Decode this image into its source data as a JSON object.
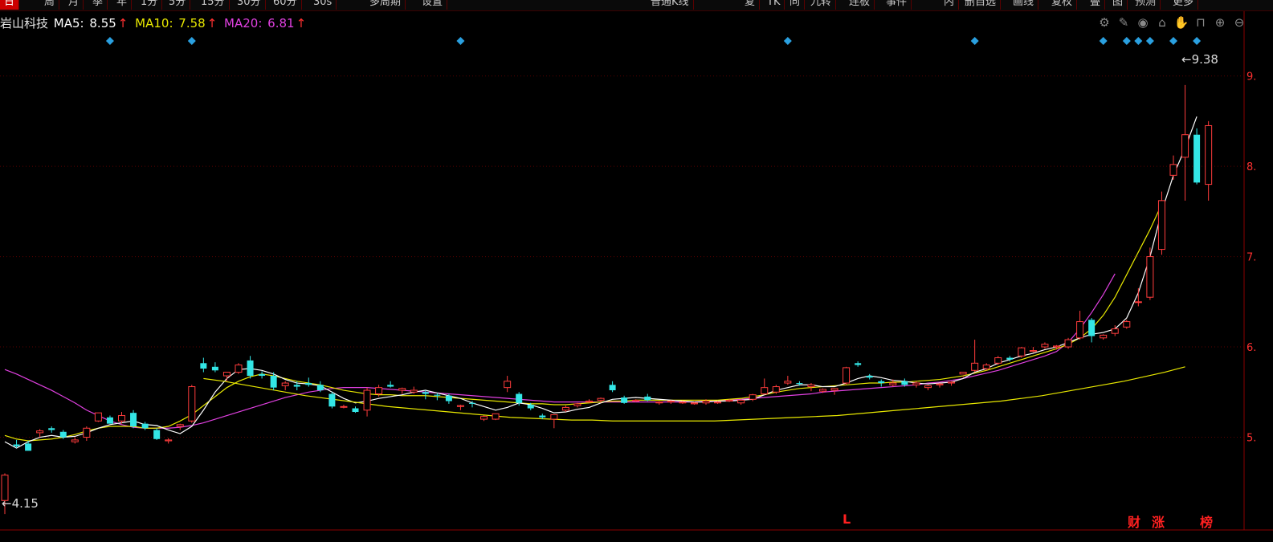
{
  "toolbar": {
    "items": [
      {
        "label": "日",
        "active": true
      },
      {
        "label": "周"
      },
      {
        "label": "月"
      },
      {
        "label": "季"
      },
      {
        "label": "年"
      },
      {
        "label": "1分"
      },
      {
        "label": "5分"
      },
      {
        "label": "15分"
      },
      {
        "label": "30分"
      },
      {
        "label": "60分"
      },
      {
        "label": "30s"
      },
      {
        "label": "多周期"
      },
      {
        "label": "设置"
      }
    ],
    "right_items": [
      {
        "label": "普通K线"
      },
      {
        "label": "复"
      },
      {
        "label": "TK"
      },
      {
        "label": "同"
      },
      {
        "label": "九转"
      },
      {
        "label": "连板"
      },
      {
        "label": "事件"
      },
      {
        "label": "内"
      },
      {
        "label": "删自选"
      },
      {
        "label": "画线"
      },
      {
        "label": "复权"
      },
      {
        "label": "叠"
      },
      {
        "label": "图"
      },
      {
        "label": "预测"
      },
      {
        "label": "更多"
      }
    ]
  },
  "info": {
    "stock_name": "岩山科技",
    "ma5_label": "MA5:",
    "ma5_value": "8.55",
    "ma10_label": "MA10:",
    "ma10_value": "7.58",
    "ma20_label": "MA20:",
    "ma20_value": "6.81",
    "up_arrow": "↑"
  },
  "tools": [
    "gear-icon",
    "pen-icon",
    "eye-icon",
    "basket-icon",
    "hand-icon",
    "lock-icon",
    "zoom-in-icon",
    "zoom-out-icon"
  ],
  "tool_glyphs": [
    "⚙",
    "✎",
    "◉",
    "⌂",
    "✋",
    "⊓",
    "⊕",
    "⊖"
  ],
  "badges": {
    "l": "L",
    "cai": "财",
    "zhang": "涨",
    "bang": "榜"
  },
  "chart_data": {
    "type": "candlestick",
    "up_color": "#ff3c3c",
    "down_color": "#33e6e6",
    "ma5_color": "#ffffff",
    "ma10_color": "#e8e800",
    "ma20_color": "#e040e0",
    "grid_color": "#5a0000",
    "y_ticks": [
      "9.",
      "8.",
      "7.",
      "6.",
      "5."
    ],
    "ylim": [
      4.0,
      9.45
    ],
    "high_label": "9.38",
    "low_label": "4.15",
    "marker_candles": [
      9,
      16,
      39,
      67,
      83,
      94,
      96,
      97,
      98,
      100,
      102
    ],
    "ohlc": [
      [
        4.3,
        4.6,
        4.15,
        4.58
      ],
      [
        4.92,
        4.97,
        4.88,
        4.9
      ],
      [
        4.93,
        4.96,
        4.87,
        4.85
      ],
      [
        5.05,
        5.09,
        5.0,
        5.07
      ],
      [
        5.1,
        5.12,
        5.05,
        5.08
      ],
      [
        5.06,
        5.08,
        4.98,
        5.0
      ],
      [
        4.95,
        5.0,
        4.93,
        4.97
      ],
      [
        5.0,
        5.12,
        4.96,
        5.1
      ],
      [
        5.18,
        5.27,
        5.17,
        5.27
      ],
      [
        5.22,
        5.24,
        5.15,
        5.15
      ],
      [
        5.18,
        5.28,
        5.15,
        5.24
      ],
      [
        5.27,
        5.3,
        5.1,
        5.12
      ],
      [
        5.15,
        5.17,
        5.08,
        5.1
      ],
      [
        5.08,
        5.1,
        4.97,
        4.98
      ],
      [
        4.96,
        4.99,
        4.93,
        4.97
      ],
      [
        5.12,
        5.15,
        5.08,
        5.14
      ],
      [
        5.18,
        5.58,
        5.16,
        5.56
      ],
      [
        5.82,
        5.88,
        5.72,
        5.76
      ],
      [
        5.78,
        5.83,
        5.72,
        5.74
      ],
      [
        5.68,
        5.72,
        5.62,
        5.72
      ],
      [
        5.72,
        5.82,
        5.7,
        5.8
      ],
      [
        5.85,
        5.9,
        5.65,
        5.68
      ],
      [
        5.7,
        5.73,
        5.65,
        5.68
      ],
      [
        5.68,
        5.72,
        5.52,
        5.55
      ],
      [
        5.57,
        5.62,
        5.52,
        5.6
      ],
      [
        5.58,
        5.62,
        5.52,
        5.56
      ],
      [
        5.6,
        5.66,
        5.56,
        5.58
      ],
      [
        5.58,
        5.62,
        5.5,
        5.52
      ],
      [
        5.48,
        5.5,
        5.32,
        5.34
      ],
      [
        5.34,
        5.36,
        5.32,
        5.34
      ],
      [
        5.32,
        5.34,
        5.27,
        5.28
      ],
      [
        5.3,
        5.55,
        5.23,
        5.52
      ],
      [
        5.48,
        5.58,
        5.45,
        5.55
      ],
      [
        5.58,
        5.62,
        5.55,
        5.56
      ],
      [
        5.52,
        5.55,
        5.48,
        5.54
      ],
      [
        5.5,
        5.56,
        5.48,
        5.52
      ],
      [
        5.5,
        5.52,
        5.42,
        5.48
      ],
      [
        5.47,
        5.49,
        5.41,
        5.46
      ],
      [
        5.46,
        5.48,
        5.37,
        5.4
      ],
      [
        5.34,
        5.36,
        5.3,
        5.35
      ],
      [
        5.38,
        5.4,
        5.33,
        5.37
      ],
      [
        5.2,
        5.24,
        5.18,
        5.23
      ],
      [
        5.2,
        5.25,
        5.19,
        5.26
      ],
      [
        5.55,
        5.68,
        5.5,
        5.62
      ],
      [
        5.48,
        5.5,
        5.35,
        5.38
      ],
      [
        5.36,
        5.38,
        5.3,
        5.32
      ],
      [
        5.24,
        5.26,
        5.2,
        5.22
      ],
      [
        5.2,
        5.24,
        5.1,
        5.25
      ],
      [
        5.3,
        5.35,
        5.28,
        5.33
      ],
      [
        5.35,
        5.38,
        5.33,
        5.37
      ],
      [
        5.39,
        5.42,
        5.38,
        5.4
      ],
      [
        5.41,
        5.44,
        5.38,
        5.43
      ],
      [
        5.58,
        5.62,
        5.5,
        5.52
      ],
      [
        5.44,
        5.46,
        5.37,
        5.38
      ],
      [
        5.4,
        5.42,
        5.39,
        5.41
      ],
      [
        5.45,
        5.48,
        5.4,
        5.41
      ],
      [
        5.38,
        5.4,
        5.36,
        5.39
      ],
      [
        5.39,
        5.41,
        5.37,
        5.4
      ],
      [
        5.38,
        5.4,
        5.37,
        5.39
      ],
      [
        5.37,
        5.39,
        5.36,
        5.38
      ],
      [
        5.38,
        5.42,
        5.36,
        5.4
      ],
      [
        5.38,
        5.4,
        5.37,
        5.39
      ],
      [
        5.4,
        5.42,
        5.39,
        5.41
      ],
      [
        5.38,
        5.42,
        5.36,
        5.41
      ],
      [
        5.42,
        5.48,
        5.4,
        5.47
      ],
      [
        5.48,
        5.65,
        5.47,
        5.55
      ],
      [
        5.5,
        5.58,
        5.48,
        5.56
      ],
      [
        5.6,
        5.68,
        5.58,
        5.62
      ],
      [
        5.6,
        5.62,
        5.57,
        5.59
      ],
      [
        5.56,
        5.6,
        5.51,
        5.58
      ],
      [
        5.51,
        5.54,
        5.49,
        5.53
      ],
      [
        5.52,
        5.54,
        5.47,
        5.54
      ],
      [
        5.6,
        5.78,
        5.58,
        5.77
      ],
      [
        5.82,
        5.84,
        5.78,
        5.8
      ],
      [
        5.68,
        5.7,
        5.64,
        5.66
      ],
      [
        5.62,
        5.64,
        5.56,
        5.6
      ],
      [
        5.58,
        5.64,
        5.56,
        5.6
      ],
      [
        5.62,
        5.65,
        5.56,
        5.58
      ],
      [
        5.58,
        5.62,
        5.55,
        5.6
      ],
      [
        5.55,
        5.58,
        5.52,
        5.57
      ],
      [
        5.58,
        5.6,
        5.55,
        5.59
      ],
      [
        5.6,
        5.62,
        5.57,
        5.61
      ],
      [
        5.7,
        5.68,
        5.66,
        5.72
      ],
      [
        5.74,
        6.08,
        5.72,
        5.82
      ],
      [
        5.76,
        5.82,
        5.74,
        5.8
      ],
      [
        5.82,
        5.9,
        5.8,
        5.88
      ],
      [
        5.88,
        5.9,
        5.84,
        5.86
      ],
      [
        5.9,
        6.0,
        5.88,
        5.99
      ],
      [
        5.95,
        6.0,
        5.94,
        5.96
      ],
      [
        6.0,
        6.05,
        5.98,
        6.03
      ],
      [
        6.0,
        6.02,
        5.97,
        6.01
      ],
      [
        6.0,
        6.1,
        5.98,
        6.08
      ],
      [
        6.1,
        6.4,
        6.08,
        6.28
      ],
      [
        6.3,
        6.32,
        6.05,
        6.12
      ],
      [
        6.1,
        6.14,
        6.08,
        6.13
      ],
      [
        6.15,
        6.24,
        6.12,
        6.2
      ],
      [
        6.22,
        6.3,
        6.2,
        6.28
      ],
      [
        6.5,
        6.65,
        6.45,
        6.5
      ],
      [
        6.55,
        7.1,
        6.52,
        7.0
      ],
      [
        7.08,
        7.72,
        7.02,
        7.62
      ],
      [
        7.9,
        8.12,
        7.85,
        8.02
      ],
      [
        8.1,
        8.9,
        7.62,
        8.35
      ],
      [
        8.35,
        8.42,
        7.8,
        7.82
      ],
      [
        7.8,
        8.5,
        7.62,
        8.45
      ]
    ],
    "ma5": [
      4.95,
      4.88,
      4.95,
      5.0,
      5.02,
      5.0,
      5.01,
      5.05,
      5.1,
      5.14,
      5.16,
      5.18,
      5.14,
      5.13,
      5.08,
      5.04,
      5.12,
      5.3,
      5.5,
      5.65,
      5.75,
      5.76,
      5.74,
      5.7,
      5.64,
      5.6,
      5.59,
      5.57,
      5.5,
      5.43,
      5.38,
      5.4,
      5.43,
      5.45,
      5.47,
      5.5,
      5.52,
      5.49,
      5.46,
      5.43,
      5.38,
      5.34,
      5.3,
      5.33,
      5.38,
      5.36,
      5.32,
      5.27,
      5.28,
      5.31,
      5.33,
      5.38,
      5.42,
      5.43,
      5.44,
      5.43,
      5.42,
      5.41,
      5.4,
      5.39,
      5.39,
      5.4,
      5.4,
      5.41,
      5.42,
      5.47,
      5.52,
      5.55,
      5.58,
      5.58,
      5.56,
      5.56,
      5.6,
      5.65,
      5.68,
      5.66,
      5.63,
      5.62,
      5.6,
      5.59,
      5.6,
      5.61,
      5.65,
      5.72,
      5.76,
      5.82,
      5.86,
      5.9,
      5.93,
      5.97,
      6.0,
      6.05,
      6.1,
      6.14,
      6.16,
      6.2,
      6.32,
      6.6,
      7.0,
      7.5,
      7.9,
      8.2,
      8.55
    ],
    "ma10": [
      5.02,
      4.98,
      4.96,
      4.97,
      4.98,
      5.0,
      5.03,
      5.07,
      5.1,
      5.12,
      5.12,
      5.12,
      5.1,
      5.1,
      5.12,
      5.18,
      5.25,
      5.35,
      5.45,
      5.55,
      5.62,
      5.67,
      5.7,
      5.68,
      5.65,
      5.62,
      5.6,
      5.58,
      5.55,
      5.52,
      5.5,
      5.48,
      5.47,
      5.47,
      5.46,
      5.46,
      5.46,
      5.45,
      5.44,
      5.43,
      5.42,
      5.41,
      5.4,
      5.39,
      5.38,
      5.37,
      5.37,
      5.36,
      5.36,
      5.37,
      5.38,
      5.39,
      5.4,
      5.4,
      5.41,
      5.41,
      5.41,
      5.41,
      5.41,
      5.41,
      5.41,
      5.41,
      5.42,
      5.43,
      5.45,
      5.47,
      5.5,
      5.52,
      5.54,
      5.55,
      5.56,
      5.57,
      5.58,
      5.59,
      5.6,
      5.6,
      5.61,
      5.61,
      5.62,
      5.63,
      5.64,
      5.66,
      5.68,
      5.71,
      5.74,
      5.78,
      5.82,
      5.86,
      5.9,
      5.94,
      5.98,
      6.03,
      6.1,
      6.2,
      6.35,
      6.55,
      6.8,
      7.05,
      7.3,
      7.58
    ],
    "ma20": [
      5.75,
      5.7,
      5.64,
      5.58,
      5.52,
      5.45,
      5.38,
      5.3,
      5.24,
      5.18,
      5.14,
      5.11,
      5.1,
      5.1,
      5.1,
      5.11,
      5.13,
      5.16,
      5.2,
      5.24,
      5.28,
      5.32,
      5.36,
      5.4,
      5.44,
      5.47,
      5.5,
      5.52,
      5.54,
      5.55,
      5.55,
      5.55,
      5.54,
      5.53,
      5.52,
      5.51,
      5.5,
      5.49,
      5.48,
      5.47,
      5.46,
      5.45,
      5.44,
      5.43,
      5.42,
      5.41,
      5.4,
      5.39,
      5.39,
      5.39,
      5.39,
      5.39,
      5.39,
      5.39,
      5.39,
      5.39,
      5.39,
      5.39,
      5.39,
      5.39,
      5.4,
      5.4,
      5.41,
      5.42,
      5.43,
      5.44,
      5.45,
      5.46,
      5.47,
      5.48,
      5.5,
      5.51,
      5.52,
      5.53,
      5.54,
      5.55,
      5.56,
      5.57,
      5.58,
      5.6,
      5.61,
      5.63,
      5.65,
      5.68,
      5.71,
      5.74,
      5.78,
      5.82,
      5.86,
      5.9,
      5.95,
      6.05,
      6.2,
      6.38,
      6.58,
      6.81
    ],
    "long_ma": [
      5.65,
      5.62,
      5.58,
      5.54,
      5.5,
      5.46,
      5.43,
      5.4,
      5.37,
      5.34,
      5.32,
      5.3,
      5.28,
      5.26,
      5.24,
      5.22,
      5.21,
      5.2,
      5.19,
      5.19,
      5.18,
      5.18,
      5.18,
      5.18,
      5.18,
      5.18,
      5.19,
      5.2,
      5.21,
      5.22,
      5.23,
      5.24,
      5.26,
      5.28,
      5.3,
      5.32,
      5.34,
      5.36,
      5.38,
      5.4,
      5.43,
      5.46,
      5.5,
      5.54,
      5.58,
      5.62,
      5.67,
      5.72,
      5.78
    ]
  }
}
